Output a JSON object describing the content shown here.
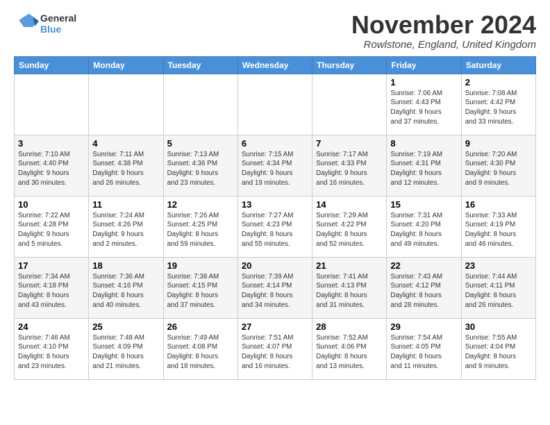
{
  "logo": {
    "line1": "General",
    "line2": "Blue"
  },
  "title": "November 2024",
  "location": "Rowlstone, England, United Kingdom",
  "days_of_week": [
    "Sunday",
    "Monday",
    "Tuesday",
    "Wednesday",
    "Thursday",
    "Friday",
    "Saturday"
  ],
  "weeks": [
    [
      {
        "day": "",
        "info": ""
      },
      {
        "day": "",
        "info": ""
      },
      {
        "day": "",
        "info": ""
      },
      {
        "day": "",
        "info": ""
      },
      {
        "day": "",
        "info": ""
      },
      {
        "day": "1",
        "info": "Sunrise: 7:06 AM\nSunset: 4:43 PM\nDaylight: 9 hours\nand 37 minutes."
      },
      {
        "day": "2",
        "info": "Sunrise: 7:08 AM\nSunset: 4:42 PM\nDaylight: 9 hours\nand 33 minutes."
      }
    ],
    [
      {
        "day": "3",
        "info": "Sunrise: 7:10 AM\nSunset: 4:40 PM\nDaylight: 9 hours\nand 30 minutes."
      },
      {
        "day": "4",
        "info": "Sunrise: 7:11 AM\nSunset: 4:38 PM\nDaylight: 9 hours\nand 26 minutes."
      },
      {
        "day": "5",
        "info": "Sunrise: 7:13 AM\nSunset: 4:36 PM\nDaylight: 9 hours\nand 23 minutes."
      },
      {
        "day": "6",
        "info": "Sunrise: 7:15 AM\nSunset: 4:34 PM\nDaylight: 9 hours\nand 19 minutes."
      },
      {
        "day": "7",
        "info": "Sunrise: 7:17 AM\nSunset: 4:33 PM\nDaylight: 9 hours\nand 16 minutes."
      },
      {
        "day": "8",
        "info": "Sunrise: 7:19 AM\nSunset: 4:31 PM\nDaylight: 9 hours\nand 12 minutes."
      },
      {
        "day": "9",
        "info": "Sunrise: 7:20 AM\nSunset: 4:30 PM\nDaylight: 9 hours\nand 9 minutes."
      }
    ],
    [
      {
        "day": "10",
        "info": "Sunrise: 7:22 AM\nSunset: 4:28 PM\nDaylight: 9 hours\nand 5 minutes."
      },
      {
        "day": "11",
        "info": "Sunrise: 7:24 AM\nSunset: 4:26 PM\nDaylight: 9 hours\nand 2 minutes."
      },
      {
        "day": "12",
        "info": "Sunrise: 7:26 AM\nSunset: 4:25 PM\nDaylight: 8 hours\nand 59 minutes."
      },
      {
        "day": "13",
        "info": "Sunrise: 7:27 AM\nSunset: 4:23 PM\nDaylight: 8 hours\nand 55 minutes."
      },
      {
        "day": "14",
        "info": "Sunrise: 7:29 AM\nSunset: 4:22 PM\nDaylight: 8 hours\nand 52 minutes."
      },
      {
        "day": "15",
        "info": "Sunrise: 7:31 AM\nSunset: 4:20 PM\nDaylight: 8 hours\nand 49 minutes."
      },
      {
        "day": "16",
        "info": "Sunrise: 7:33 AM\nSunset: 4:19 PM\nDaylight: 8 hours\nand 46 minutes."
      }
    ],
    [
      {
        "day": "17",
        "info": "Sunrise: 7:34 AM\nSunset: 4:18 PM\nDaylight: 8 hours\nand 43 minutes."
      },
      {
        "day": "18",
        "info": "Sunrise: 7:36 AM\nSunset: 4:16 PM\nDaylight: 8 hours\nand 40 minutes."
      },
      {
        "day": "19",
        "info": "Sunrise: 7:38 AM\nSunset: 4:15 PM\nDaylight: 8 hours\nand 37 minutes."
      },
      {
        "day": "20",
        "info": "Sunrise: 7:39 AM\nSunset: 4:14 PM\nDaylight: 8 hours\nand 34 minutes."
      },
      {
        "day": "21",
        "info": "Sunrise: 7:41 AM\nSunset: 4:13 PM\nDaylight: 8 hours\nand 31 minutes."
      },
      {
        "day": "22",
        "info": "Sunrise: 7:43 AM\nSunset: 4:12 PM\nDaylight: 8 hours\nand 28 minutes."
      },
      {
        "day": "23",
        "info": "Sunrise: 7:44 AM\nSunset: 4:11 PM\nDaylight: 8 hours\nand 26 minutes."
      }
    ],
    [
      {
        "day": "24",
        "info": "Sunrise: 7:46 AM\nSunset: 4:10 PM\nDaylight: 8 hours\nand 23 minutes."
      },
      {
        "day": "25",
        "info": "Sunrise: 7:48 AM\nSunset: 4:09 PM\nDaylight: 8 hours\nand 21 minutes."
      },
      {
        "day": "26",
        "info": "Sunrise: 7:49 AM\nSunset: 4:08 PM\nDaylight: 8 hours\nand 18 minutes."
      },
      {
        "day": "27",
        "info": "Sunrise: 7:51 AM\nSunset: 4:07 PM\nDaylight: 8 hours\nand 16 minutes."
      },
      {
        "day": "28",
        "info": "Sunrise: 7:52 AM\nSunset: 4:06 PM\nDaylight: 8 hours\nand 13 minutes."
      },
      {
        "day": "29",
        "info": "Sunrise: 7:54 AM\nSunset: 4:05 PM\nDaylight: 8 hours\nand 11 minutes."
      },
      {
        "day": "30",
        "info": "Sunrise: 7:55 AM\nSunset: 4:04 PM\nDaylight: 8 hours\nand 9 minutes."
      }
    ]
  ]
}
